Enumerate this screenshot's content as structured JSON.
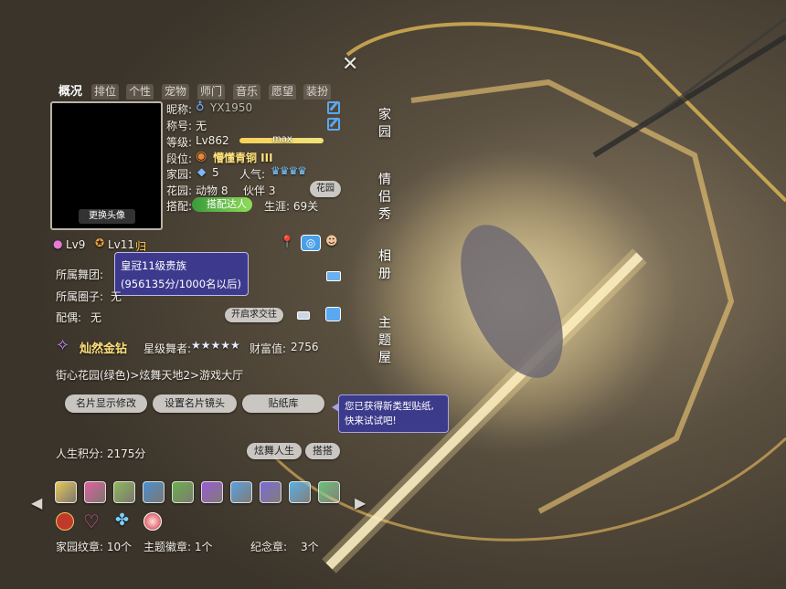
{
  "tabs": [
    "概况",
    "排位",
    "个性",
    "宠物",
    "师门",
    "音乐",
    "愿望",
    "装扮"
  ],
  "avatar": {
    "change_label": "更换头像"
  },
  "profile": {
    "nickname_label": "昵称:",
    "nickname": "YX1950",
    "title_label": "称号:",
    "title": "无",
    "level_label": "等级:",
    "level": "Lv862",
    "level_max": "max",
    "rank_label": "段位:",
    "rank": "懵懂青铜 III",
    "home_label": "家园:",
    "home_value": "5",
    "popularity_label": "人气:",
    "garden_label": "花园:",
    "garden_animals": "动物 8",
    "garden_partners": "伙伴 3",
    "garden_button": "花园",
    "match_label": "搭配:",
    "match_badge": "搭配达人",
    "career": "生涯: 69关"
  },
  "levels": {
    "lv_a": "Lv9",
    "lv_b": "Lv11",
    "lv_b_suffix": "归"
  },
  "tooltip": {
    "line1": "皇冠11级贵族",
    "line2": "(956135分/1000名以后)"
  },
  "affiliations": {
    "dance_group_label": "所属舞团:",
    "circle_label": "所属圈子:",
    "circle_value": "无",
    "spouse_label": "配偶:",
    "spouse_value": "无",
    "open_request": "开启求交往"
  },
  "vip": {
    "name": "灿然金钻",
    "star_dancer_label": "星级舞者:",
    "stars": "★★★★★",
    "wealth_label": "财富值:",
    "wealth_value": "2756"
  },
  "location": "街心花园(绿色)>炫舞天地2>游戏大厅",
  "buttons": {
    "card_edit": "名片显示修改",
    "card_lens": "设置名片镜头",
    "sticker_lib": "贴纸库",
    "dance_life": "炫舞人生",
    "match": "搭搭"
  },
  "sticker_hint": {
    "line1": "您已获得新类型贴纸,",
    "line2": "快来试试吧!"
  },
  "life_points": "人生积分: 2175分",
  "counts": {
    "home_badge": "家园纹章: 10个",
    "theme_badge": "主题徽章: 1个",
    "memorial_label": "纪念章:",
    "memorial_value": "3个"
  },
  "right_menu": [
    "家园",
    "情侣秀",
    "相册",
    "主题屋"
  ],
  "badge_colors": [
    "#e7c85a",
    "#e060a0",
    "#8fb85a",
    "#4a8fd0",
    "#6ab04c",
    "#9a5ad8",
    "#5aa0e0",
    "#7a6ad8",
    "#58b0e8",
    "#6ac07a"
  ],
  "colors": {
    "accent_purple": "#3d3a8e",
    "rank_gold": "#ffe27a",
    "vip_gold": "#ffe07a"
  }
}
